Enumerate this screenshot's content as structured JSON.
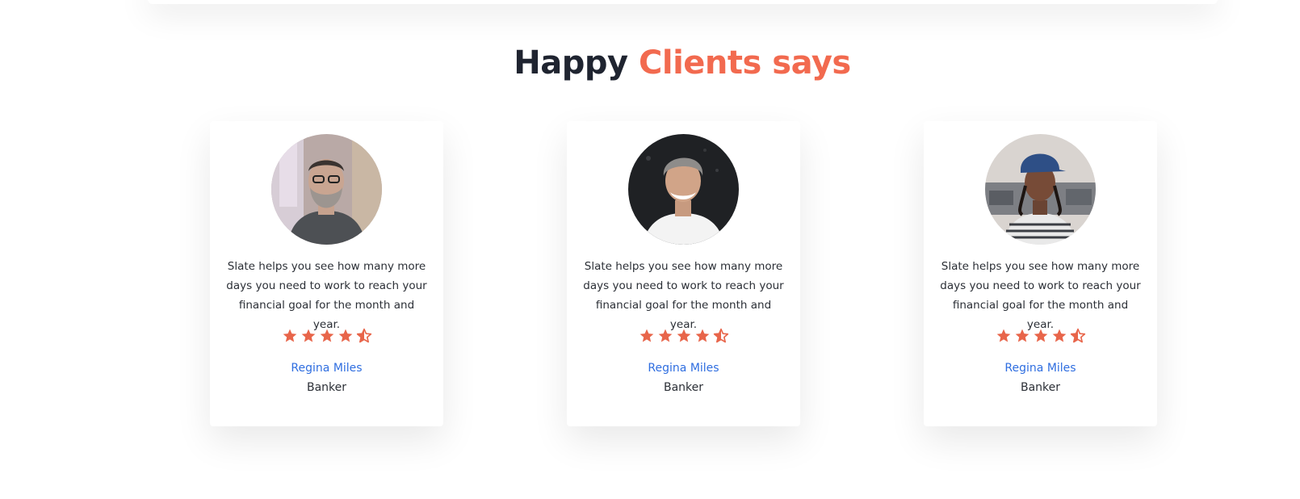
{
  "section": {
    "title_part1": "Happy",
    "title_part2": "Clients says"
  },
  "colors": {
    "accent": "#f26a4f",
    "star": "#e8654a",
    "name_link": "#2f6ee0",
    "text": "#2b2f36"
  },
  "testimonials": [
    {
      "quote": "Slate helps you see how many more days you need to work to reach your financial goal for the month and year.",
      "rating": 4.5,
      "name": "Regina Miles",
      "role": "Banker",
      "avatar_icon": "avatar-photo"
    },
    {
      "quote": "Slate helps you see how many more days you need to work to reach your financial goal for the month and year.",
      "rating": 4.5,
      "name": "Regina Miles",
      "role": "Banker",
      "avatar_icon": "avatar-photo"
    },
    {
      "quote": "Slate helps you see how many more days you need to work to reach your financial goal for the month and year.",
      "rating": 4.5,
      "name": "Regina Miles",
      "role": "Banker",
      "avatar_icon": "avatar-photo"
    }
  ]
}
